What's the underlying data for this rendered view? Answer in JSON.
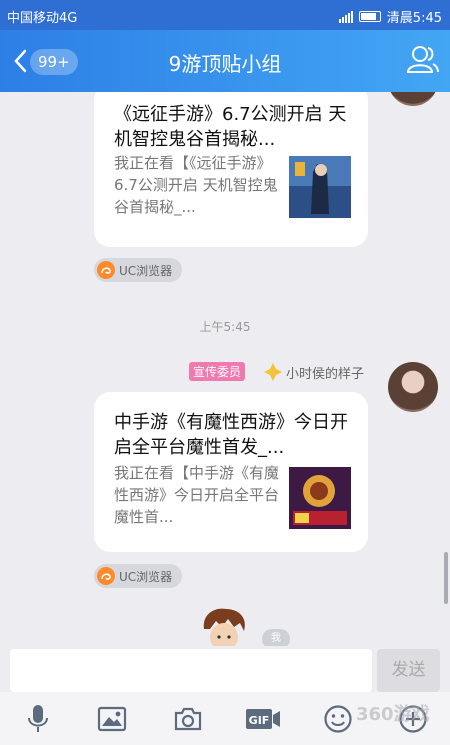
{
  "status": {
    "carrier": "中国移动4G",
    "time_text": "清晨5:45"
  },
  "header": {
    "unread_badge": "99+",
    "title": "9游顶贴小组"
  },
  "messages": [
    {
      "title": "《远征手游》6.7公测开启 天机智控鬼谷首揭秘...",
      "desc": "我正在看【《远征手游》6.7公测开启 天机智控鬼谷首揭秘_...",
      "source": "UC浏览器"
    },
    {
      "timestamp": "上午5:45",
      "role_tag": "宣传委员",
      "sender": "小时侯的样子",
      "title": "中手游《有魔性西游》今日开启全平台魔性首发_...",
      "desc": "我正在看【中手游《有魔性西游》今日开启全平台魔性首...",
      "source": "UC浏览器"
    },
    {
      "self_label": "我"
    }
  ],
  "composer": {
    "send_label": "发送"
  },
  "watermark": "360游戏"
}
